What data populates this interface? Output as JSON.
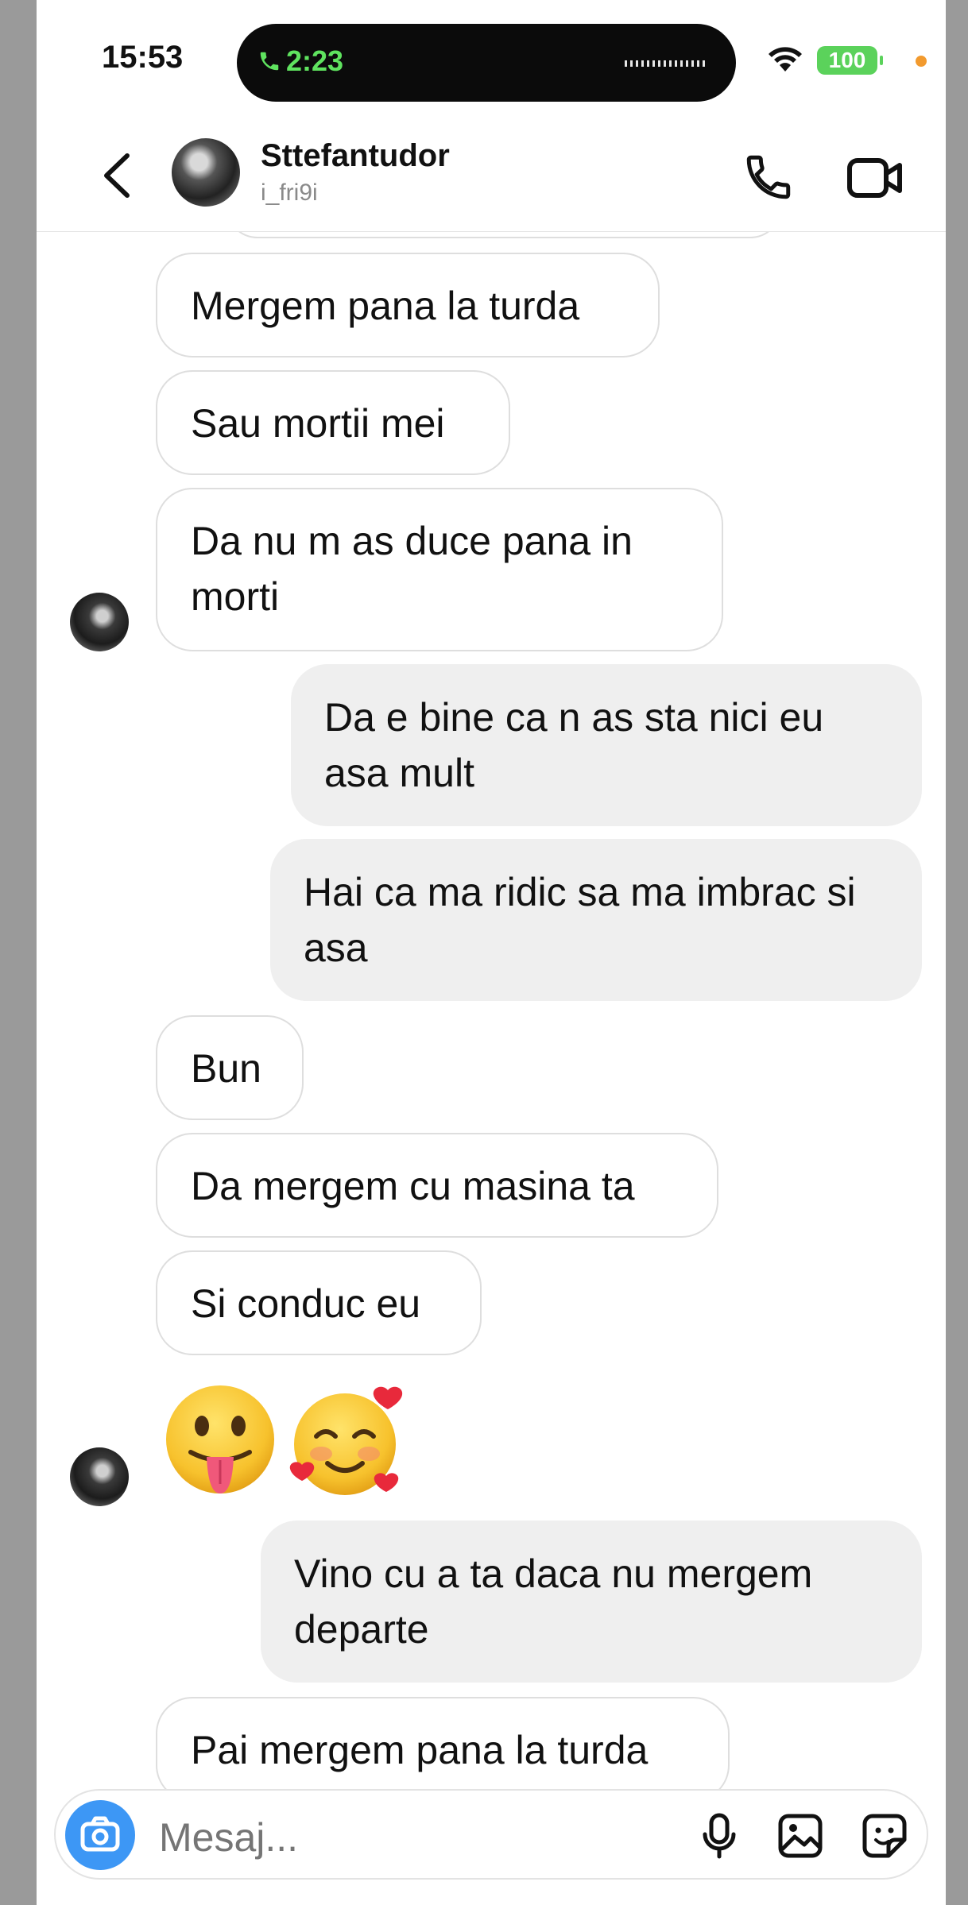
{
  "status": {
    "time": "15:53",
    "call_duration": "2:23",
    "battery": "100"
  },
  "header": {
    "name": "Sttefantudor",
    "handle": "i_fri9i",
    "icons": [
      "back-icon",
      "phone-icon",
      "video-icon"
    ]
  },
  "messages": [
    {
      "side": "in",
      "text": "Mergem pana la turda"
    },
    {
      "side": "in",
      "text": "Sau mortii mei"
    },
    {
      "side": "in",
      "text": "Da nu m as duce pana in morti"
    },
    {
      "side": "out",
      "text": "Da e bine ca n as sta nici eu asa mult"
    },
    {
      "side": "out",
      "text": "Hai ca ma ridic sa ma imbrac si asa"
    },
    {
      "side": "in",
      "text": "Bun"
    },
    {
      "side": "in",
      "text": "Da mergem cu masina ta"
    },
    {
      "side": "in",
      "text": "Si conduc eu"
    },
    {
      "side": "in",
      "emoji": [
        "tongue-out-face",
        "smiling-face-with-hearts"
      ]
    },
    {
      "side": "out",
      "text": "Vino cu a ta daca nu mergem departe"
    },
    {
      "side": "in",
      "text": "Pai mergem pana la turda"
    }
  ],
  "composer": {
    "placeholder": "Mesaj...",
    "icons": [
      "camera-icon",
      "microphone-icon",
      "gallery-icon",
      "sticker-icon"
    ]
  },
  "colors": {
    "accent": "#3d97f5",
    "call_green": "#5fe35f",
    "battery_green": "#5bd25b",
    "outgoing_bubble": "#efefef"
  }
}
